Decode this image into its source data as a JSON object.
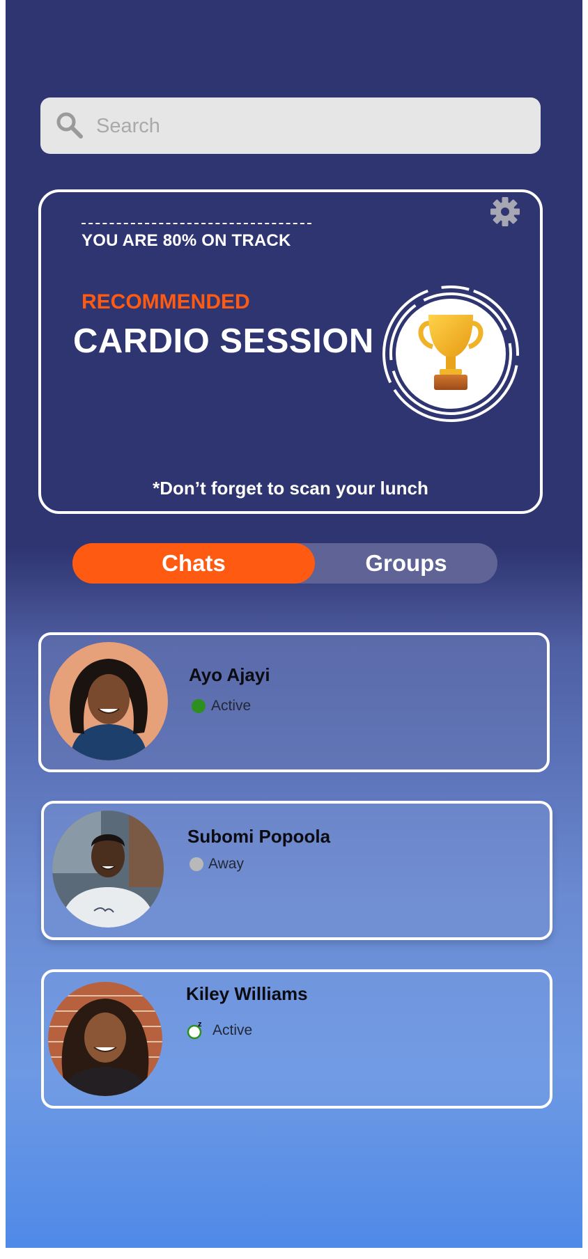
{
  "search": {
    "placeholder": "Search",
    "icon": "search-icon"
  },
  "recommendation": {
    "progress_text": "YOU ARE 80% ON TRACK",
    "progress_percent": 80,
    "label": "RECOMMENDED",
    "title": "CARDIO SESSION",
    "note": "*Don’t forget to scan your lunch",
    "badge_icon": "trophy-icon",
    "settings_icon": "gear-icon",
    "label_color": "#ff5a12"
  },
  "tabs": {
    "items": [
      {
        "label": "Chats",
        "active": true
      },
      {
        "label": "Groups",
        "active": false
      }
    ],
    "active_color": "#ff5a12"
  },
  "contacts": [
    {
      "name": "Ayo Ajayi",
      "status": "Active",
      "status_indicator": "online-dot",
      "status_color": "#2c8f1e"
    },
    {
      "name": "Subomi Popoola",
      "status": "Away",
      "status_indicator": "away-dot",
      "status_color": "#b9b9b9"
    },
    {
      "name": "Kiley Williams",
      "status": "Active",
      "status_indicator": "idle-sleep-icon",
      "status_color": "#2c8f1e"
    }
  ],
  "colors": {
    "background_top": "#2f3571",
    "background_bottom": "#4f8ae8",
    "accent": "#ff5a12"
  }
}
